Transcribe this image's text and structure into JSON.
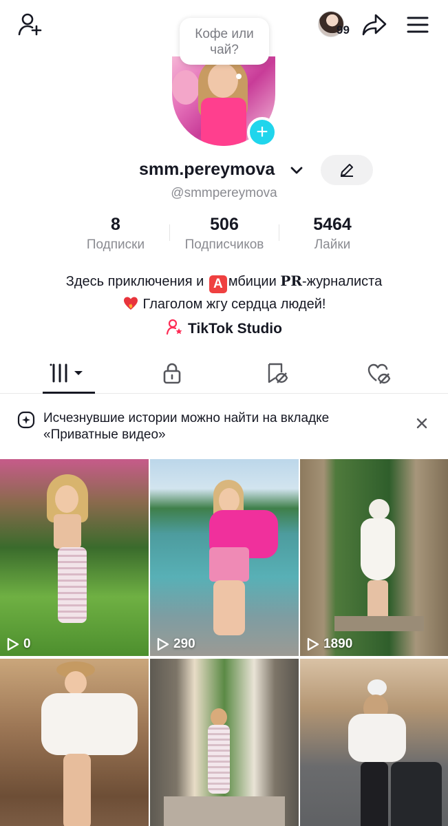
{
  "profile": {
    "username": "smm.pereymova",
    "handle": "@smmpereymova",
    "story_bubble": "Кофе или чай?",
    "story_count": "99"
  },
  "stats": [
    {
      "value": "8",
      "label": "Подписки"
    },
    {
      "value": "506",
      "label": "Подписчиков"
    },
    {
      "value": "5464",
      "label": "Лайки"
    }
  ],
  "bio": {
    "line1_prefix": "Здесь приключения и ",
    "line1_badge": "A",
    "line1_mid": "мбиции ",
    "line1_bold": "PR",
    "line1_suffix": "-журналиста",
    "line2": "Глаголом жгу сердца людей!"
  },
  "studio_link": "TikTok Studio",
  "tabs": [
    {
      "name": "videos",
      "icon": "grid-icon"
    },
    {
      "name": "private",
      "icon": "lock-icon"
    },
    {
      "name": "saved",
      "icon": "bookmark-eye-off-icon"
    },
    {
      "name": "liked",
      "icon": "heart-eye-off-icon"
    }
  ],
  "notice": {
    "text": "Исчезнувшие истории можно найти на вкладке «Приватные видео»"
  },
  "videos": [
    {
      "views": "0"
    },
    {
      "views": "290"
    },
    {
      "views": "1890"
    },
    {
      "views": ""
    },
    {
      "views": ""
    },
    {
      "views": ""
    }
  ],
  "colors": {
    "accent_cyan": "#20d5ec",
    "text_primary": "#161823",
    "text_secondary": "#8a8b91",
    "badge_red": "#ef4040",
    "studio_pink": "#fe2c55"
  }
}
